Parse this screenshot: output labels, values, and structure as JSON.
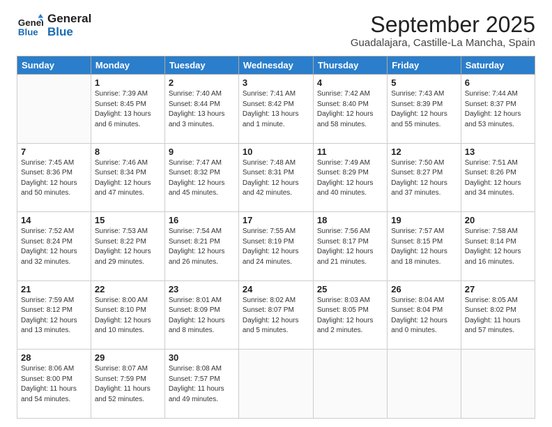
{
  "logo": {
    "line1": "General",
    "line2": "Blue"
  },
  "title": "September 2025",
  "subtitle": "Guadalajara, Castille-La Mancha, Spain",
  "weekdays": [
    "Sunday",
    "Monday",
    "Tuesday",
    "Wednesday",
    "Thursday",
    "Friday",
    "Saturday"
  ],
  "weeks": [
    [
      {
        "day": "",
        "info": ""
      },
      {
        "day": "1",
        "info": "Sunrise: 7:39 AM\nSunset: 8:45 PM\nDaylight: 13 hours\nand 6 minutes."
      },
      {
        "day": "2",
        "info": "Sunrise: 7:40 AM\nSunset: 8:44 PM\nDaylight: 13 hours\nand 3 minutes."
      },
      {
        "day": "3",
        "info": "Sunrise: 7:41 AM\nSunset: 8:42 PM\nDaylight: 13 hours\nand 1 minute."
      },
      {
        "day": "4",
        "info": "Sunrise: 7:42 AM\nSunset: 8:40 PM\nDaylight: 12 hours\nand 58 minutes."
      },
      {
        "day": "5",
        "info": "Sunrise: 7:43 AM\nSunset: 8:39 PM\nDaylight: 12 hours\nand 55 minutes."
      },
      {
        "day": "6",
        "info": "Sunrise: 7:44 AM\nSunset: 8:37 PM\nDaylight: 12 hours\nand 53 minutes."
      }
    ],
    [
      {
        "day": "7",
        "info": "Sunrise: 7:45 AM\nSunset: 8:36 PM\nDaylight: 12 hours\nand 50 minutes."
      },
      {
        "day": "8",
        "info": "Sunrise: 7:46 AM\nSunset: 8:34 PM\nDaylight: 12 hours\nand 47 minutes."
      },
      {
        "day": "9",
        "info": "Sunrise: 7:47 AM\nSunset: 8:32 PM\nDaylight: 12 hours\nand 45 minutes."
      },
      {
        "day": "10",
        "info": "Sunrise: 7:48 AM\nSunset: 8:31 PM\nDaylight: 12 hours\nand 42 minutes."
      },
      {
        "day": "11",
        "info": "Sunrise: 7:49 AM\nSunset: 8:29 PM\nDaylight: 12 hours\nand 40 minutes."
      },
      {
        "day": "12",
        "info": "Sunrise: 7:50 AM\nSunset: 8:27 PM\nDaylight: 12 hours\nand 37 minutes."
      },
      {
        "day": "13",
        "info": "Sunrise: 7:51 AM\nSunset: 8:26 PM\nDaylight: 12 hours\nand 34 minutes."
      }
    ],
    [
      {
        "day": "14",
        "info": "Sunrise: 7:52 AM\nSunset: 8:24 PM\nDaylight: 12 hours\nand 32 minutes."
      },
      {
        "day": "15",
        "info": "Sunrise: 7:53 AM\nSunset: 8:22 PM\nDaylight: 12 hours\nand 29 minutes."
      },
      {
        "day": "16",
        "info": "Sunrise: 7:54 AM\nSunset: 8:21 PM\nDaylight: 12 hours\nand 26 minutes."
      },
      {
        "day": "17",
        "info": "Sunrise: 7:55 AM\nSunset: 8:19 PM\nDaylight: 12 hours\nand 24 minutes."
      },
      {
        "day": "18",
        "info": "Sunrise: 7:56 AM\nSunset: 8:17 PM\nDaylight: 12 hours\nand 21 minutes."
      },
      {
        "day": "19",
        "info": "Sunrise: 7:57 AM\nSunset: 8:15 PM\nDaylight: 12 hours\nand 18 minutes."
      },
      {
        "day": "20",
        "info": "Sunrise: 7:58 AM\nSunset: 8:14 PM\nDaylight: 12 hours\nand 16 minutes."
      }
    ],
    [
      {
        "day": "21",
        "info": "Sunrise: 7:59 AM\nSunset: 8:12 PM\nDaylight: 12 hours\nand 13 minutes."
      },
      {
        "day": "22",
        "info": "Sunrise: 8:00 AM\nSunset: 8:10 PM\nDaylight: 12 hours\nand 10 minutes."
      },
      {
        "day": "23",
        "info": "Sunrise: 8:01 AM\nSunset: 8:09 PM\nDaylight: 12 hours\nand 8 minutes."
      },
      {
        "day": "24",
        "info": "Sunrise: 8:02 AM\nSunset: 8:07 PM\nDaylight: 12 hours\nand 5 minutes."
      },
      {
        "day": "25",
        "info": "Sunrise: 8:03 AM\nSunset: 8:05 PM\nDaylight: 12 hours\nand 2 minutes."
      },
      {
        "day": "26",
        "info": "Sunrise: 8:04 AM\nSunset: 8:04 PM\nDaylight: 12 hours\nand 0 minutes."
      },
      {
        "day": "27",
        "info": "Sunrise: 8:05 AM\nSunset: 8:02 PM\nDaylight: 11 hours\nand 57 minutes."
      }
    ],
    [
      {
        "day": "28",
        "info": "Sunrise: 8:06 AM\nSunset: 8:00 PM\nDaylight: 11 hours\nand 54 minutes."
      },
      {
        "day": "29",
        "info": "Sunrise: 8:07 AM\nSunset: 7:59 PM\nDaylight: 11 hours\nand 52 minutes."
      },
      {
        "day": "30",
        "info": "Sunrise: 8:08 AM\nSunset: 7:57 PM\nDaylight: 11 hours\nand 49 minutes."
      },
      {
        "day": "",
        "info": ""
      },
      {
        "day": "",
        "info": ""
      },
      {
        "day": "",
        "info": ""
      },
      {
        "day": "",
        "info": ""
      }
    ]
  ]
}
